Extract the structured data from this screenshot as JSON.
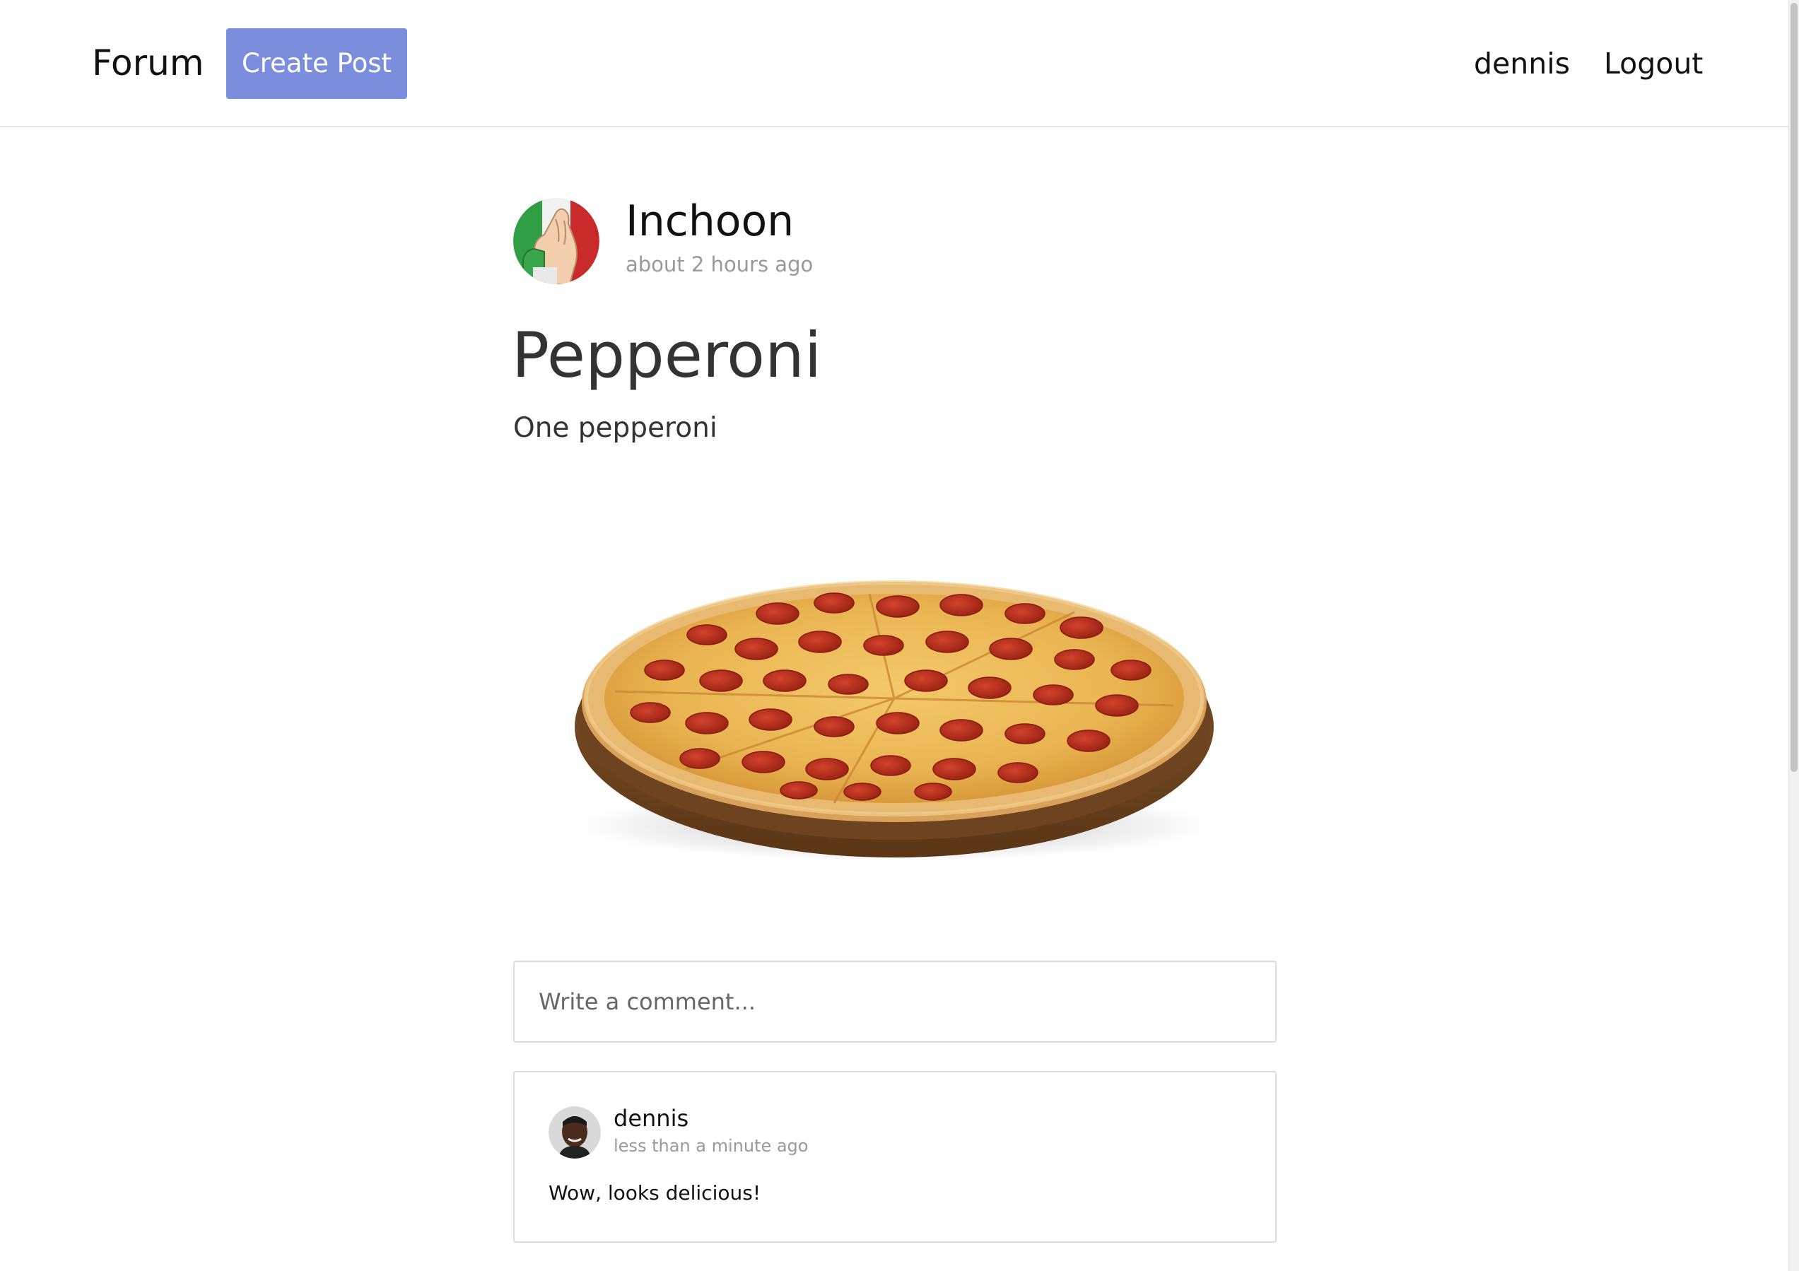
{
  "header": {
    "brand": "Forum",
    "create_post_label": "Create Post",
    "user_name": "dennis",
    "logout_label": "Logout"
  },
  "post": {
    "author": "Inchoon",
    "time": "about 2 hours ago",
    "title": "Pepperoni",
    "body": "One pepperoni",
    "image_subject": "pepperoni-pizza"
  },
  "comment_box": {
    "placeholder": "Write a comment..."
  },
  "comments": [
    {
      "author": "dennis",
      "time": "less than a minute ago",
      "text": "Wow, looks delicious!"
    }
  ],
  "colors": {
    "accent": "#7b8ddd",
    "muted_text": "#999999",
    "border": "#dcdcdc"
  }
}
